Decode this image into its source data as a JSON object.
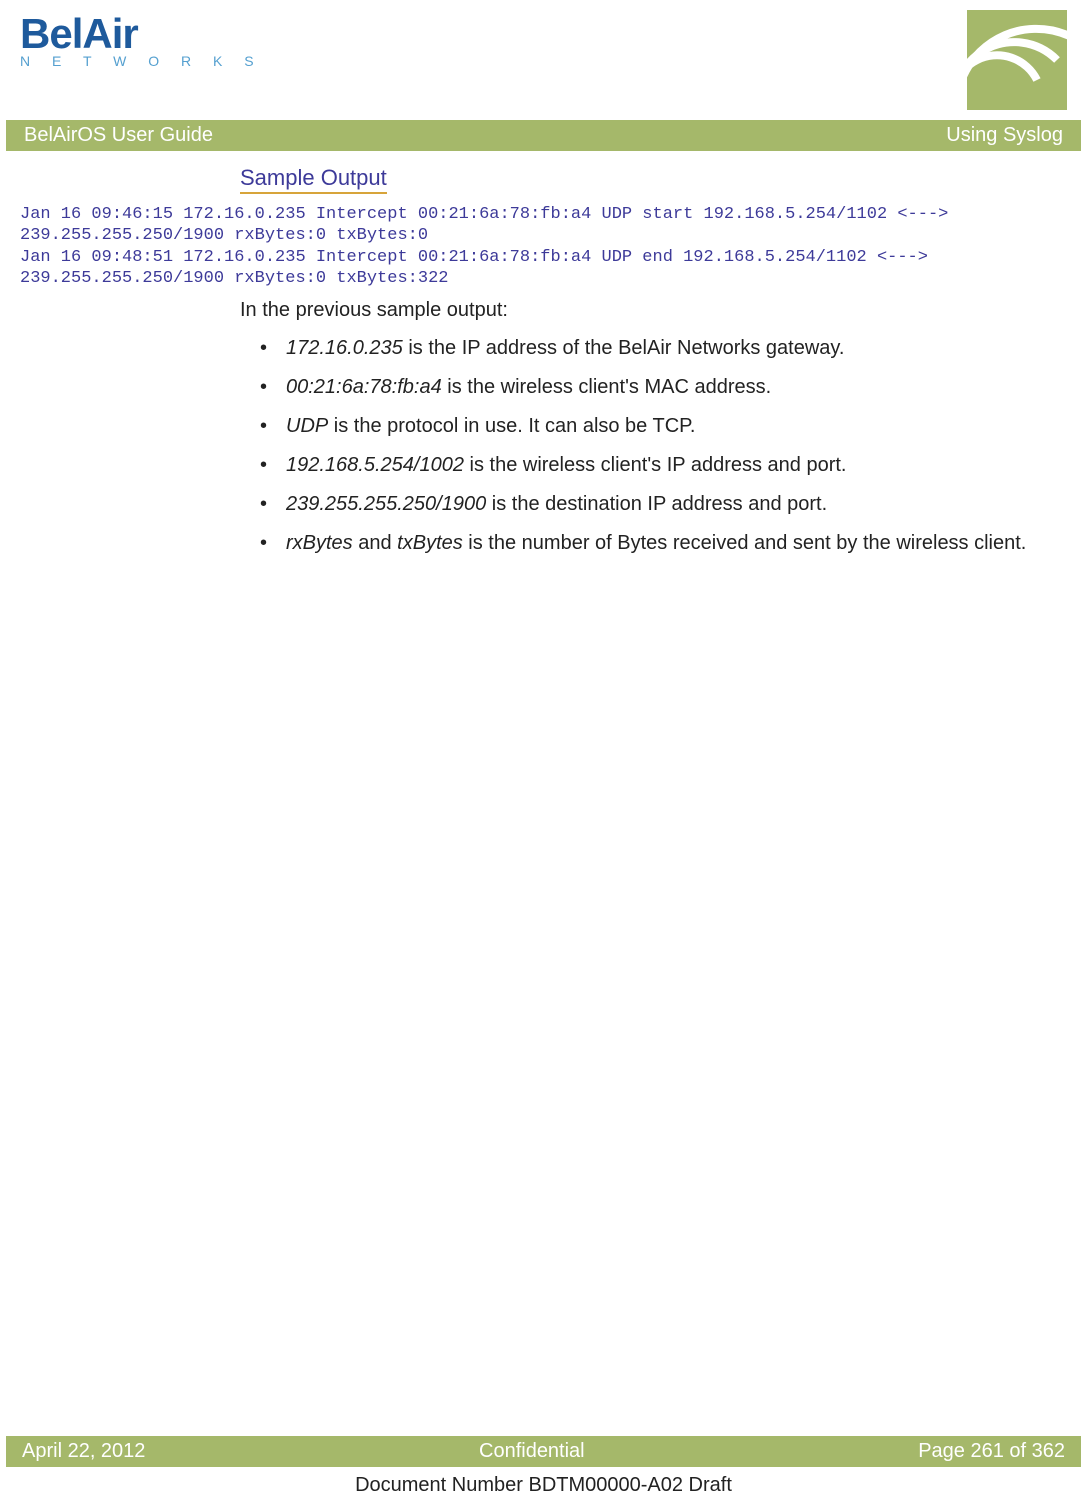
{
  "logo": {
    "main": "BelAir",
    "sub": "N E T W O R K S"
  },
  "title_bar": {
    "left": "BelAirOS User Guide",
    "right": "Using Syslog"
  },
  "section_heading": "Sample Output",
  "code": "Jan 16 09:46:15 172.16.0.235 Intercept 00:21:6a:78:fb:a4 UDP start 192.168.5.254/1102 <---> 239.255.255.250/1900 rxBytes:0 txBytes:0\nJan 16 09:48:51 172.16.0.235 Intercept 00:21:6a:78:fb:a4 UDP end 192.168.5.254/1102 <---> 239.255.255.250/1900 rxBytes:0 txBytes:322",
  "intro": "In the previous sample output:",
  "bullets": [
    {
      "em1": "172.16.0.235",
      "rest": " is the IP address of the BelAir Networks gateway."
    },
    {
      "em1": "00:21:6a:78:fb:a4",
      "rest": " is the wireless client's MAC address."
    },
    {
      "em1": "UDP",
      "rest": " is the protocol in use. It can also be TCP."
    },
    {
      "em1": "192.168.5.254/1002",
      "rest": " is the wireless client's IP address and port."
    },
    {
      "em1": "239.255.255.250/1900",
      "rest": " is the destination IP address and port."
    },
    {
      "em1": "rxBytes",
      "mid": " and ",
      "em2": "txBytes",
      "rest": " is the number of Bytes received and sent by the wireless client."
    }
  ],
  "footer": {
    "left": "April 22, 2012",
    "center": "Confidential",
    "right": "Page 261 of 362"
  },
  "doc_number": "Document Number BDTM00000-A02 Draft"
}
